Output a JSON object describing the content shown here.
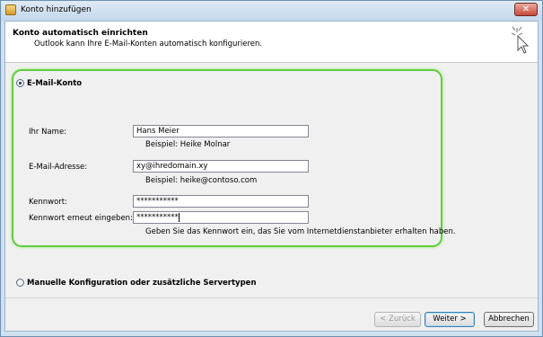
{
  "window": {
    "title": "Konto hinzufügen",
    "close_glyph": "✕"
  },
  "header": {
    "title": "Konto automatisch einrichten",
    "subtitle": "Outlook kann Ihre E-Mail-Konten automatisch konfigurieren.",
    "icon": "wizard-cursor-icon"
  },
  "email_account": {
    "label": "E-Mail-Konto",
    "selected": true,
    "name": {
      "label": "Ihr Name:",
      "value": "Hans Meier",
      "hint": "Beispiel: Heike Molnar"
    },
    "email": {
      "label": "E-Mail-Adresse:",
      "value": "xy@ihredomain.xy",
      "hint": "Beispiel: heike@contoso.com"
    },
    "password": {
      "label": "Kennwort:",
      "value": "***********"
    },
    "password_confirm": {
      "label": "Kennwort erneut eingeben:",
      "value": "***********"
    },
    "password_hint": "Geben Sie das Kennwort ein, das Sie vom Internetdienstanbieter erhalten haben."
  },
  "manual_config": {
    "label": "Manuelle Konfiguration oder zusätzliche Servertypen",
    "selected": false
  },
  "buttons": {
    "back": "< Zurück",
    "next": "Weiter >",
    "cancel": "Abbrechen"
  },
  "colors": {
    "highlight": "#62cc3d",
    "title_bar": "#c4d8ec"
  }
}
